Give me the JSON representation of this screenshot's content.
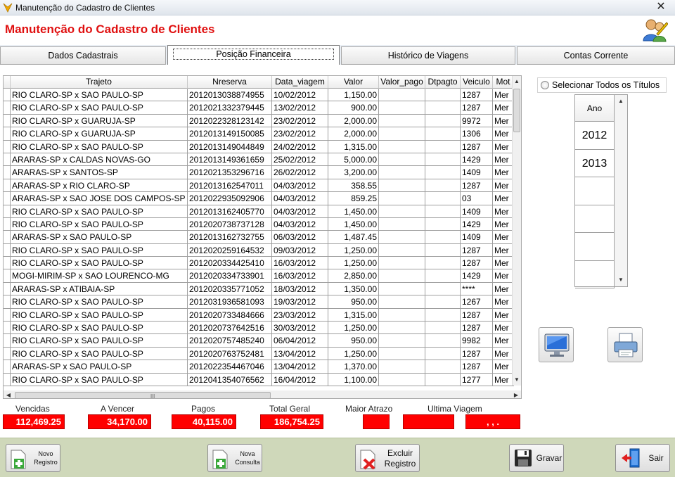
{
  "window": {
    "title": "Manutenção do Cadastro de Clientes",
    "close_glyph": "✕"
  },
  "header": {
    "heading": "Manutenção do Cadastro de Clientes"
  },
  "tabs": [
    {
      "label": "Dados Cadastrais",
      "active": false
    },
    {
      "label": "Posição Financeira",
      "active": true
    },
    {
      "label": "Histórico de Viagens",
      "active": false
    },
    {
      "label": "Contas Corrente",
      "active": false
    }
  ],
  "grid": {
    "columns": [
      "Trajeto",
      "Nreserva",
      "Data_viagem",
      "Valor",
      "Valor_pago",
      "Dtpagto",
      "Veiculo",
      "Motorista"
    ],
    "columns_shown": [
      "Trajeto",
      "Nreserva",
      "Data_viagem",
      "Valor",
      "Valor_pago",
      "Dtpagto",
      "Veiculo",
      "Mot"
    ],
    "rows": [
      {
        "trajeto": "RIO CLARO-SP x SAO PAULO-SP",
        "nreserva": "2012013038874955",
        "data": "10/02/2012",
        "valor": "1,150.00",
        "valor_pago": "",
        "dtpagto": "",
        "veiculo": "1287",
        "mot": "Mer"
      },
      {
        "trajeto": "RIO CLARO-SP x SAO PAULO-SP",
        "nreserva": "2012021332379445",
        "data": "13/02/2012",
        "valor": "900.00",
        "valor_pago": "",
        "dtpagto": "",
        "veiculo": "1287",
        "mot": "Mer"
      },
      {
        "trajeto": "RIO CLARO-SP x GUARUJA-SP",
        "nreserva": "2012022328123142",
        "data": "23/02/2012",
        "valor": "2,000.00",
        "valor_pago": "",
        "dtpagto": "",
        "veiculo": "9972",
        "mot": "Mer"
      },
      {
        "trajeto": "RIO CLARO-SP x GUARUJA-SP",
        "nreserva": "2012013149150085",
        "data": "23/02/2012",
        "valor": "2,000.00",
        "valor_pago": "",
        "dtpagto": "",
        "veiculo": "1306",
        "mot": "Mer"
      },
      {
        "trajeto": "RIO CLARO-SP x SAO PAULO-SP",
        "nreserva": "2012013149044849",
        "data": "24/02/2012",
        "valor": "1,315.00",
        "valor_pago": "",
        "dtpagto": "",
        "veiculo": "1287",
        "mot": "Mer"
      },
      {
        "trajeto": "ARARAS-SP x CALDAS NOVAS-GO",
        "nreserva": "2012013149361659",
        "data": "25/02/2012",
        "valor": "5,000.00",
        "valor_pago": "",
        "dtpagto": "",
        "veiculo": "1429",
        "mot": "Mer"
      },
      {
        "trajeto": "ARARAS-SP x SANTOS-SP",
        "nreserva": "2012021353296716",
        "data": "26/02/2012",
        "valor": "3,200.00",
        "valor_pago": "",
        "dtpagto": "",
        "veiculo": "1409",
        "mot": "Mer"
      },
      {
        "trajeto": "ARARAS-SP x RIO CLARO-SP",
        "nreserva": "2012013162547011",
        "data": "04/03/2012",
        "valor": "358.55",
        "valor_pago": "",
        "dtpagto": "",
        "veiculo": "1287",
        "mot": "Mer"
      },
      {
        "trajeto": "ARARAS-SP x SAO JOSE DOS CAMPOS-SP",
        "nreserva": "2012022935092906",
        "data": "04/03/2012",
        "valor": "859.25",
        "valor_pago": "",
        "dtpagto": "",
        "veiculo": "03",
        "mot": "Mer"
      },
      {
        "trajeto": "RIO CLARO-SP x SAO PAULO-SP",
        "nreserva": "2012013162405770",
        "data": "04/03/2012",
        "valor": "1,450.00",
        "valor_pago": "",
        "dtpagto": "",
        "veiculo": "1409",
        "mot": "Mer"
      },
      {
        "trajeto": "RIO CLARO-SP x SAO PAULO-SP",
        "nreserva": "2012020738737128",
        "data": "04/03/2012",
        "valor": "1,450.00",
        "valor_pago": "",
        "dtpagto": "",
        "veiculo": "1429",
        "mot": "Mer"
      },
      {
        "trajeto": "ARARAS-SP x SAO PAULO-SP",
        "nreserva": "2012013162732755",
        "data": "06/03/2012",
        "valor": "1,487.45",
        "valor_pago": "",
        "dtpagto": "",
        "veiculo": "1409",
        "mot": "Mer"
      },
      {
        "trajeto": "RIO CLARO-SP x SAO PAULO-SP",
        "nreserva": "2012020259164532",
        "data": "09/03/2012",
        "valor": "1,250.00",
        "valor_pago": "",
        "dtpagto": "",
        "veiculo": "1287",
        "mot": "Mer"
      },
      {
        "trajeto": "RIO CLARO-SP x SAO PAULO-SP",
        "nreserva": "2012020334425410",
        "data": "16/03/2012",
        "valor": "1,250.00",
        "valor_pago": "",
        "dtpagto": "",
        "veiculo": "1287",
        "mot": "Mer"
      },
      {
        "trajeto": "MOGI-MIRIM-SP x SAO LOURENCO-MG",
        "nreserva": "2012020334733901",
        "data": "16/03/2012",
        "valor": "2,850.00",
        "valor_pago": "",
        "dtpagto": "",
        "veiculo": "1429",
        "mot": "Mer"
      },
      {
        "trajeto": "ARARAS-SP x ATIBAIA-SP",
        "nreserva": "2012020335771052",
        "data": "18/03/2012",
        "valor": "1,350.00",
        "valor_pago": "",
        "dtpagto": "",
        "veiculo": "****",
        "mot": "Mer"
      },
      {
        "trajeto": "RIO CLARO-SP x SAO PAULO-SP",
        "nreserva": "2012031936581093",
        "data": "19/03/2012",
        "valor": "950.00",
        "valor_pago": "",
        "dtpagto": "",
        "veiculo": "1267",
        "mot": "Mer"
      },
      {
        "trajeto": "RIO CLARO-SP x SAO PAULO-SP",
        "nreserva": "2012020733484666",
        "data": "23/03/2012",
        "valor": "1,315.00",
        "valor_pago": "",
        "dtpagto": "",
        "veiculo": "1287",
        "mot": "Mer"
      },
      {
        "trajeto": "RIO CLARO-SP x SAO PAULO-SP",
        "nreserva": "2012020737642516",
        "data": "30/03/2012",
        "valor": "1,250.00",
        "valor_pago": "",
        "dtpagto": "",
        "veiculo": "1287",
        "mot": "Mer"
      },
      {
        "trajeto": "RIO CLARO-SP x SAO PAULO-SP",
        "nreserva": "2012020757485240",
        "data": "06/04/2012",
        "valor": "950.00",
        "valor_pago": "",
        "dtpagto": "",
        "veiculo": "9982",
        "mot": "Mer"
      },
      {
        "trajeto": "RIO CLARO-SP x SAO PAULO-SP",
        "nreserva": "2012020763752481",
        "data": "13/04/2012",
        "valor": "1,250.00",
        "valor_pago": "",
        "dtpagto": "",
        "veiculo": "1287",
        "mot": "Mer"
      },
      {
        "trajeto": "ARARAS-SP x SAO PAULO-SP",
        "nreserva": "2012022354467046",
        "data": "13/04/2012",
        "valor": "1,370.00",
        "valor_pago": "",
        "dtpagto": "",
        "veiculo": "1287",
        "mot": "Mer"
      },
      {
        "trajeto": "RIO CLARO-SP x SAO PAULO-SP",
        "nreserva": "2012041354076562",
        "data": "16/04/2012",
        "valor": "1,100.00",
        "valor_pago": "",
        "dtpagto": "",
        "veiculo": "1277",
        "mot": "Mer"
      }
    ]
  },
  "filter": {
    "select_all_label": "Selecionar Todos os Títulos",
    "ano_header": "Ano",
    "anos": [
      "2012",
      "2013",
      "",
      "",
      "",
      ""
    ]
  },
  "totals": [
    {
      "label": "Vencidas",
      "value": "112,469.25"
    },
    {
      "label": "A Vencer",
      "value": "34,170.00"
    },
    {
      "label": "Pagos",
      "value": "40,115.00"
    },
    {
      "label": "Total Geral",
      "value": "186,754.25"
    },
    {
      "label": "Maior Atrazo",
      "value": ""
    },
    {
      "label": "Ultima Viagem",
      "value": ""
    },
    {
      "label": "",
      "value": ", , ."
    }
  ],
  "buttons": {
    "novo_registro": [
      "Novo",
      "Registro"
    ],
    "nova_consulta": [
      "Nova",
      "Consulta"
    ],
    "excluir_registro": [
      "Excluir",
      "Registro"
    ],
    "gravar": "Gravar",
    "sair": "Sair"
  },
  "colors": {
    "accent_red": "#ff0000",
    "heading_red": "#e01010",
    "bottom_bar": "#cfd8ba"
  }
}
